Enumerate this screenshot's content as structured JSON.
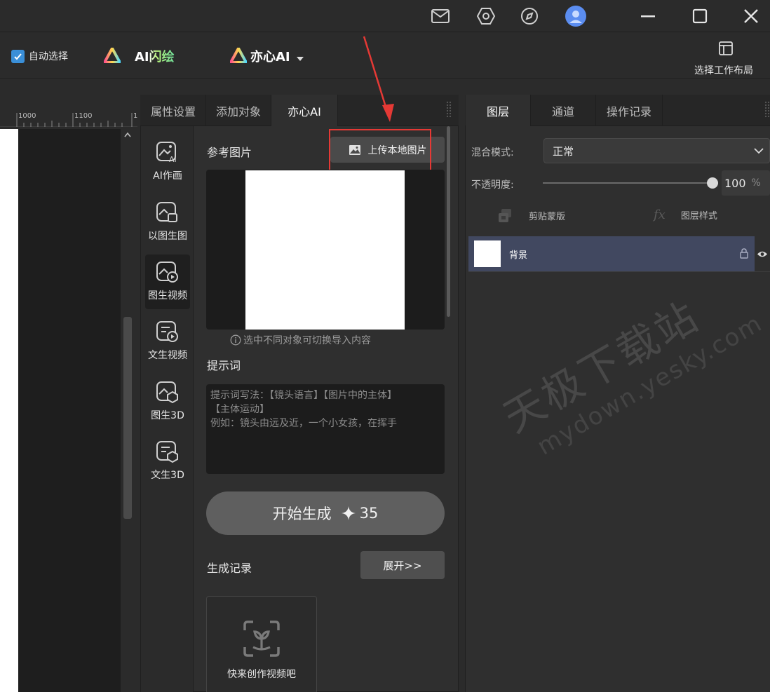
{
  "toolbar": {
    "auto_select_label": "自动选择",
    "ai_flash_label": "AI闪绘",
    "yixin_ai_label": "亦心AI",
    "workspace_layout_label": "选择工作布局"
  },
  "ruler": {
    "marks": [
      "1000",
      "1100",
      "1"
    ]
  },
  "middle_panel": {
    "tabs": [
      {
        "label": "属性设置",
        "active": false
      },
      {
        "label": "添加对象",
        "active": false
      },
      {
        "label": "亦心AI",
        "active": true
      }
    ],
    "rail": [
      {
        "label": "AI作画",
        "icon": "ai-image-icon"
      },
      {
        "label": "以图生图",
        "icon": "image-to-image-icon"
      },
      {
        "label": "图生视频",
        "icon": "image-to-video-icon",
        "active": true
      },
      {
        "label": "文生视频",
        "icon": "text-to-video-icon"
      },
      {
        "label": "图生3D",
        "icon": "image-to-3d-icon"
      },
      {
        "label": "文生3D",
        "icon": "text-to-3d-icon"
      }
    ],
    "reference_title": "参考图片",
    "upload_label": "上传本地图片",
    "hint": "选中不同对象可切换导入内容",
    "prompt_title": "提示词",
    "prompt_placeholder_line1": "提示词写法：【镜头语言】【图片中的主体】",
    "prompt_placeholder_line2": "【主体运动】",
    "prompt_placeholder_line3": "例如：镜头由远及近，一个小女孩，在挥手",
    "generate_label": "开始生成",
    "generate_cost": "35",
    "history_title": "生成记录",
    "expand_label": "展开>>",
    "empty_history_label": "快来创作视频吧"
  },
  "right_panel": {
    "tabs": [
      {
        "label": "图层",
        "active": true
      },
      {
        "label": "通道",
        "active": false
      },
      {
        "label": "操作记录",
        "active": false
      }
    ],
    "blend_mode_label": "混合模式:",
    "blend_mode_value": "正常",
    "opacity_label": "不透明度:",
    "opacity_value": "100",
    "opacity_unit": "%",
    "opacity_level": 1.0,
    "clip_mask_label": "剪贴蒙版",
    "layer_style_label": "图层样式",
    "layers": [
      {
        "name": "背景"
      }
    ]
  },
  "watermark": {
    "line1": "天极下载站",
    "line2": "mydown.yesky.com"
  },
  "colors": {
    "accent_blue": "#3a8fd8",
    "highlight_red": "#e53935",
    "selected_layer": "#414860"
  }
}
